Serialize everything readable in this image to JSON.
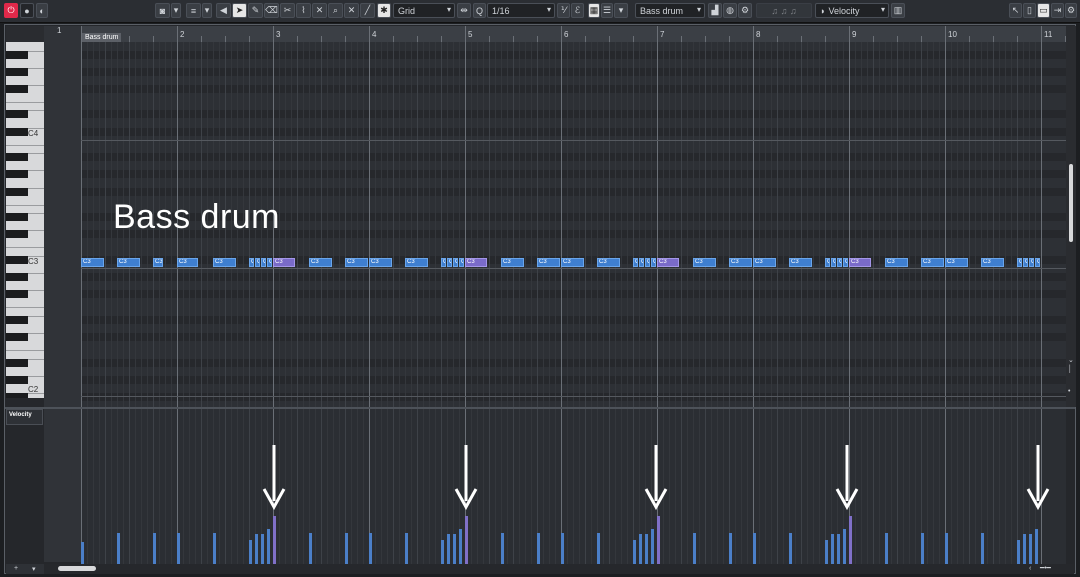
{
  "toolbar": {
    "snap_type": "Grid",
    "quantize": "1/16",
    "part_select": "Bass drum",
    "controller_select": "Velocity",
    "icons": [
      "power-icon",
      "record-icon",
      "monitor-icon",
      "camera-icon",
      "lines-icon",
      "speaker-icon",
      "arrow-icon",
      "pencil-icon",
      "eraser-icon",
      "trim-icon",
      "glue-icon",
      "mute-icon",
      "zoom-icon",
      "x-icon",
      "line-tool-icon",
      "chord-icon",
      "snap-icon",
      "snap-mode-icon",
      "quantize-icon",
      "iq-icon",
      "q-icon",
      "editor-icon",
      "step-icon",
      "info-icon",
      "midi-icon",
      "window-icon",
      "settings-icon"
    ]
  },
  "ruler": {
    "bars": [
      "2",
      "3",
      "4",
      "5",
      "6",
      "7",
      "8",
      "9",
      "10",
      "11"
    ],
    "first_bar": "1"
  },
  "part_label": "Bass drum",
  "overlay_title": "Bass drum",
  "keyboard": {
    "labels": [
      "C4",
      "C3",
      "C2"
    ]
  },
  "lane": {
    "label": "Velocity"
  },
  "notes": [
    {
      "label": "C3",
      "sel": false
    },
    {
      "label": "C3",
      "sel": false
    },
    {
      "label": "C3",
      "sel": false
    },
    {
      "label": "C3",
      "sel": false
    },
    {
      "label": "C3",
      "sel": false
    },
    {
      "label": "C",
      "sel": false
    },
    {
      "label": "C",
      "sel": false
    },
    {
      "label": "C",
      "sel": false
    },
    {
      "label": "C",
      "sel": false
    },
    {
      "label": "C3",
      "sel": true
    },
    {
      "label": "C3",
      "sel": false
    },
    {
      "label": "C3",
      "sel": false
    },
    {
      "label": "C3",
      "sel": false
    },
    {
      "label": "C3",
      "sel": false
    },
    {
      "label": "C",
      "sel": false
    },
    {
      "label": "C",
      "sel": false
    },
    {
      "label": "C",
      "sel": false
    },
    {
      "label": "C",
      "sel": false
    },
    {
      "label": "C3",
      "sel": true
    },
    {
      "label": "C3",
      "sel": false
    },
    {
      "label": "C3",
      "sel": false
    },
    {
      "label": "C3",
      "sel": false
    },
    {
      "label": "C3",
      "sel": false
    },
    {
      "label": "C",
      "sel": false
    },
    {
      "label": "C",
      "sel": false
    },
    {
      "label": "C",
      "sel": false
    },
    {
      "label": "C",
      "sel": false
    },
    {
      "label": "C3",
      "sel": true
    },
    {
      "label": "C3",
      "sel": false
    },
    {
      "label": "C3",
      "sel": false
    },
    {
      "label": "C3",
      "sel": false
    },
    {
      "label": "C3",
      "sel": false
    },
    {
      "label": "C",
      "sel": false
    },
    {
      "label": "C",
      "sel": false
    },
    {
      "label": "C",
      "sel": false
    },
    {
      "label": "C",
      "sel": false
    },
    {
      "label": "C3",
      "sel": true
    },
    {
      "label": "C3",
      "sel": false
    },
    {
      "label": "C3",
      "sel": false
    },
    {
      "label": "C3",
      "sel": false
    },
    {
      "label": "C3",
      "sel": false
    },
    {
      "label": "C",
      "sel": false
    },
    {
      "label": "C",
      "sel": false
    },
    {
      "label": "C",
      "sel": false
    },
    {
      "label": "C",
      "sel": false
    },
    {
      "label": "C",
      "sel": true
    }
  ],
  "colors": {
    "note": "#3f7fd0",
    "note_selected": "#7a6bc9",
    "velocity": "#4b7fc8",
    "velocity_selected": "#8070c8",
    "record": "#e0294a"
  }
}
